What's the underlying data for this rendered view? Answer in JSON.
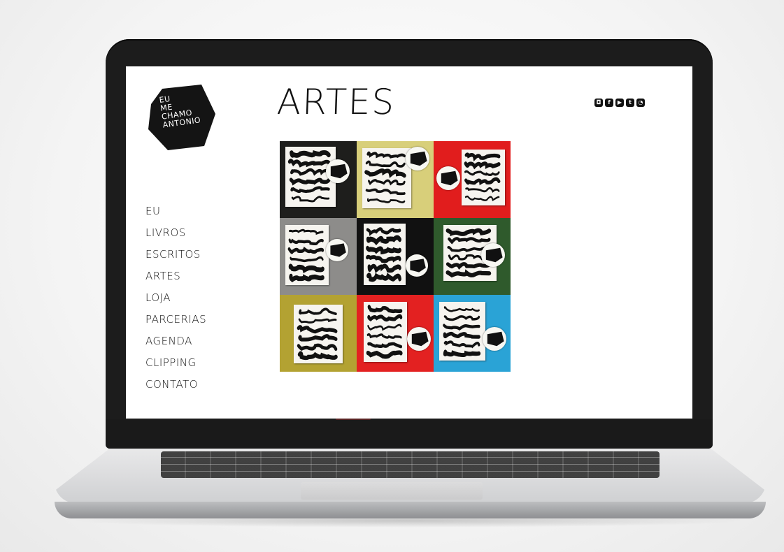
{
  "site": {
    "logo_text_lines": [
      "EU",
      "ME",
      "CHAMO",
      "ANTONIO"
    ],
    "page_title": "ARTES",
    "social_icons": [
      "instagram-icon",
      "facebook-icon",
      "youtube-icon",
      "twitter-icon",
      "rss-icon"
    ],
    "nav": [
      "EU",
      "LIVROS",
      "ESCRITOS",
      "ARTES",
      "LOJA",
      "PARCERIAS",
      "AGENDA",
      "CLIPPING",
      "CONTATO"
    ]
  },
  "gallery": {
    "tiles": [
      {
        "bg": "#1e1e1c",
        "art": "QUEM ENCHE CHEI SE SAGUE"
      },
      {
        "bg": "#d8cf7a",
        "art": "de que adianta"
      },
      {
        "bg": "#e11d1d",
        "art": "ADENDO ADENTRO"
      },
      {
        "bg": "#8d8c8a",
        "art": ""
      },
      {
        "bg": "#111111",
        "art": ""
      },
      {
        "bg": "#2f5a2c",
        "art": "a gente enche a nossa"
      },
      {
        "bg": "#b3a232",
        "art": ""
      },
      {
        "bg": "#e32121",
        "art": ""
      },
      {
        "bg": "#2aa3d6",
        "art": "NÃO ME AGUENTE VOCÊ QUE ME SUPORTARIA LONGE"
      }
    ]
  }
}
